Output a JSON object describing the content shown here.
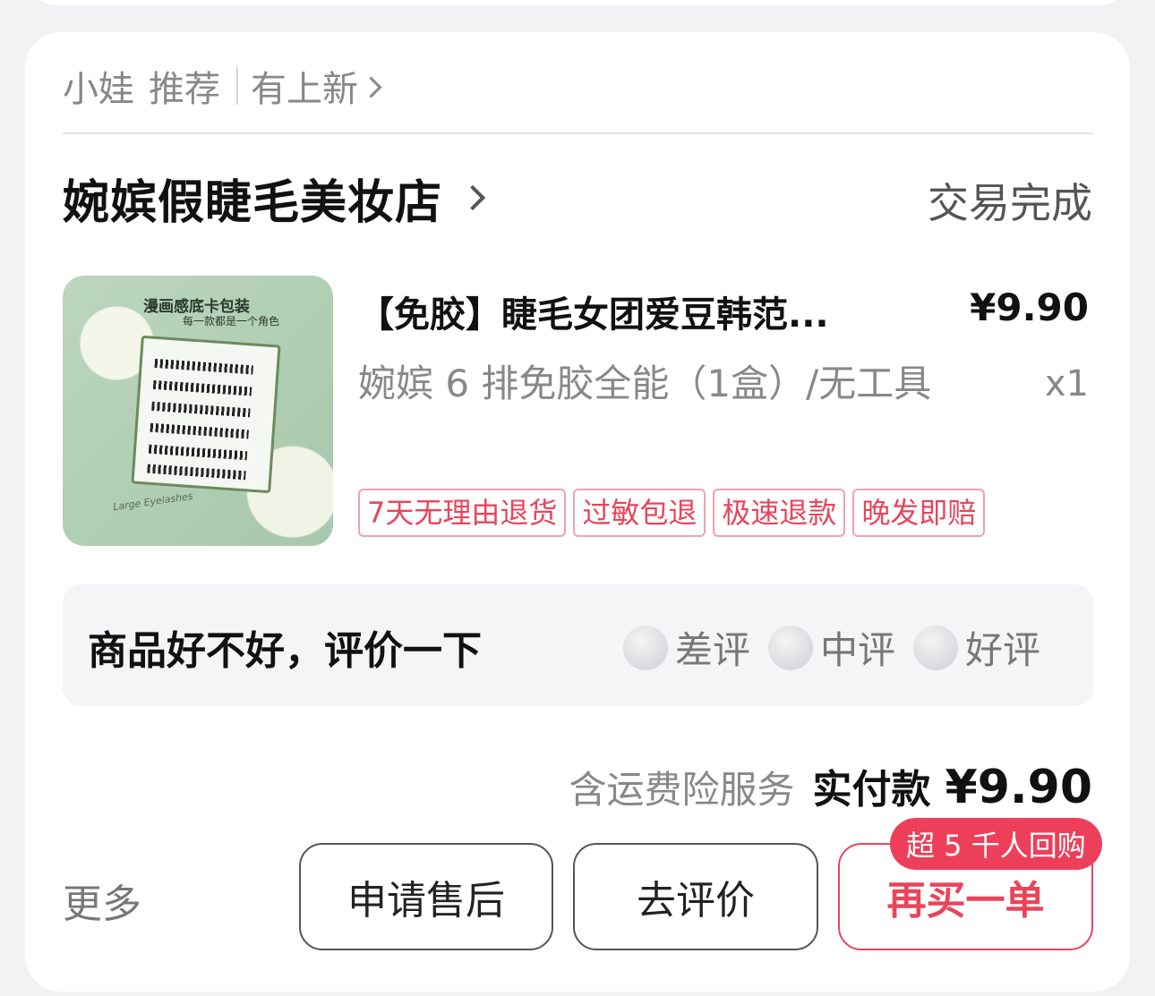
{
  "recommend": {
    "label1": "小娃",
    "label2": "推荐",
    "link": "有上新"
  },
  "shop": {
    "name": "婉嫔假睫毛美妆店",
    "status": "交易完成"
  },
  "product": {
    "title": "【免胶】睫毛女团爱豆韩范...",
    "price": "¥9.90",
    "spec": "婉嫔 6 排免胶全能（1盒）/无工具",
    "qty": "x1",
    "image_text": {
      "line1": "漫画感底卡包装",
      "line2": "每一款都是一个角色",
      "line3": "Large Eyelashes"
    },
    "tags": [
      "7天无理由退货",
      "过敏包退",
      "极速退款",
      "晚发即赔"
    ]
  },
  "review": {
    "question": "商品好不好，评价一下",
    "options": [
      {
        "label": "差评",
        "icon": "sad-face-icon"
      },
      {
        "label": "中评",
        "icon": "neutral-face-icon"
      },
      {
        "label": "好评",
        "icon": "happy-face-icon"
      }
    ]
  },
  "payment": {
    "note": "含运费险服务",
    "label": "实付款",
    "amount": "¥9.90"
  },
  "actions": {
    "more": "更多",
    "after_sale": "申请售后",
    "review": "去评价",
    "rebuy": "再买一单",
    "rebuy_badge": "超 5 千人回购"
  },
  "colors": {
    "accent_red": "#e8455b",
    "badge_red": "#ee3f5a"
  }
}
